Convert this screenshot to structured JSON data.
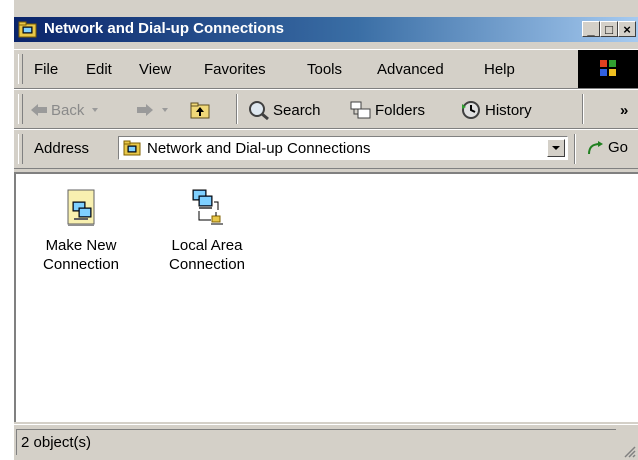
{
  "window": {
    "title": "Network and Dial-up Connections",
    "controls": {
      "minimize": "_",
      "maximize": "□",
      "close": "×"
    }
  },
  "menu": {
    "items": [
      "File",
      "Edit",
      "View",
      "Favorites",
      "Tools",
      "Advanced",
      "Help"
    ]
  },
  "toolbar": {
    "back_label": "Back",
    "search_label": "Search",
    "folders_label": "Folders",
    "history_label": "History",
    "overflow": "»"
  },
  "address": {
    "label": "Address",
    "value": "Network and Dial-up Connections",
    "go_label": "Go"
  },
  "content": {
    "items": [
      {
        "label": "Make New Connection",
        "icon": "make-new-connection-icon"
      },
      {
        "label": "Local Area Connection",
        "icon": "local-area-connection-icon"
      }
    ]
  },
  "status": {
    "text": "2 object(s)"
  },
  "colors": {
    "titlebar_start": "#0a246a",
    "titlebar_end": "#a6caf0",
    "chrome": "#d4d0c8"
  }
}
